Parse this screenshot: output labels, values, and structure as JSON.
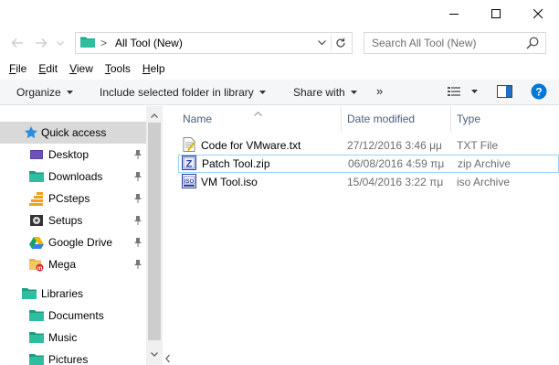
{
  "window": {
    "controls": [
      "minimize-icon",
      "maximize-icon",
      "close-icon"
    ]
  },
  "address": {
    "path": "All Tool (New)",
    "separator": ">",
    "search_placeholder": "Search All Tool (New)"
  },
  "menu": {
    "items": [
      {
        "label": "File",
        "key": "F"
      },
      {
        "label": "Edit",
        "key": "E"
      },
      {
        "label": "View",
        "key": "V"
      },
      {
        "label": "Tools",
        "key": "T"
      },
      {
        "label": "Help",
        "key": "H"
      }
    ]
  },
  "toolbar": {
    "organize": "Organize",
    "include": "Include selected folder in library",
    "share": "Share with",
    "more": "»"
  },
  "nav": {
    "quick_access": "Quick access",
    "items": [
      {
        "label": "Desktop",
        "icon": "desktop-icon",
        "pinned": true
      },
      {
        "label": "Downloads",
        "icon": "downloads-folder-icon",
        "pinned": true
      },
      {
        "label": "PCsteps",
        "icon": "pcsteps-folder-icon",
        "pinned": true
      },
      {
        "label": "Setups",
        "icon": "setups-folder-icon",
        "pinned": true
      },
      {
        "label": "Google Drive",
        "icon": "google-drive-icon",
        "pinned": true
      },
      {
        "label": "Mega",
        "icon": "mega-folder-icon",
        "pinned": true
      }
    ],
    "libraries": "Libraries",
    "library_items": [
      {
        "label": "Documents",
        "icon": "documents-folder-icon"
      },
      {
        "label": "Music",
        "icon": "music-folder-icon"
      },
      {
        "label": "Pictures",
        "icon": "pictures-folder-icon"
      }
    ]
  },
  "columns": {
    "name": "Name",
    "date": "Date modified",
    "type": "Type"
  },
  "files": [
    {
      "name": "Code for VMware.txt",
      "date": "27/12/2016 3:46 μμ",
      "type": "TXT File",
      "icon": "text-file-icon"
    },
    {
      "name": "Patch Tool.zip",
      "date": "06/08/2016 4:59 πμ",
      "type": "zip Archive",
      "icon": "zip-file-icon"
    },
    {
      "name": "VM Tool.iso",
      "date": "15/04/2016 3:22 πμ",
      "type": "iso Archive",
      "icon": "iso-file-icon"
    }
  ],
  "colors": {
    "accent": "#0078d7",
    "folder_teal": "#21a98f",
    "selection": "#cce8ff",
    "header_text": "#4c607a"
  }
}
